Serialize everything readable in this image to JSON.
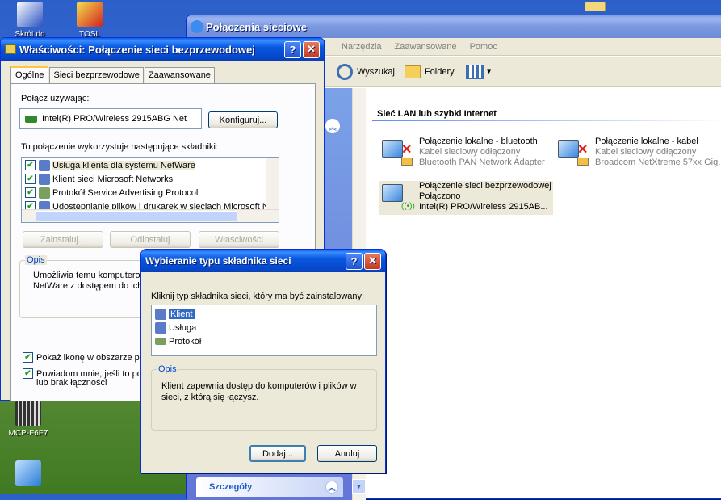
{
  "desktop": {
    "icons": [
      {
        "label": "Skrót do",
        "x": 0
      },
      {
        "label": "TOSL"
      },
      {
        "label": "MCP-F6F7"
      }
    ]
  },
  "explorer": {
    "title": "Połączenia sieciowe",
    "menu": [
      "Narzędzia",
      "Zaawansowane",
      "Pomoc"
    ],
    "toolbar": {
      "search": "Wyszukaj",
      "folders": "Foldery"
    },
    "group_header": "Sieć LAN lub szybki Internet",
    "connections": [
      {
        "name": "Połączenie lokalne - bluetooth",
        "status": "Kabel sieciowy odłączony",
        "device": "Bluetooth PAN Network Adapter"
      },
      {
        "name": "Połączenie lokalne - kabel",
        "status": "Kabel sieciowy odłączony",
        "device": "Broadcom NetXtreme 57xx Gig..."
      },
      {
        "name": "Połączenie sieci bezprzewodowej",
        "status": "Połączono",
        "device": "Intel(R) PRO/Wireless 2915AB..."
      }
    ],
    "details_label": "Szczegóły"
  },
  "props": {
    "title": "Właściwości: Połączenie sieci bezprzewodowej",
    "tabs": [
      "Ogólne",
      "Sieci bezprzewodowe",
      "Zaawansowane"
    ],
    "connect_using_label": "Połącz używając:",
    "adapter": "Intel(R) PRO/Wireless 2915ABG Net",
    "configure": "Konfiguruj...",
    "components_label": "To połączenie wykorzystuje następujące składniki:",
    "components": [
      "Usługa klienta dla systemu NetWare",
      "Klient sieci Microsoft Networks",
      "Protokół Service Advertising Protocol",
      "Udostępnianie plików i drukarek w sieciach Microsoft N"
    ],
    "install": "Zainstaluj...",
    "uninstall": "Odinstaluj",
    "properties": "Właściwości",
    "desc_label": "Opis",
    "desc_line1": "Umożliwia temu komputerow",
    "desc_line2": "NetWare z dostępem do ich",
    "show_icon": "Pokaż ikonę w obszarze pov",
    "notify_line1": "Powiadom mnie, jeśli to poła",
    "notify_line2": "lub brak łączności"
  },
  "dialog": {
    "title": "Wybieranie typu składnika sieci",
    "prompt": "Kliknij typ składnika sieci, który ma być zainstalowany:",
    "items": [
      "Klient",
      "Usługa",
      "Protokół"
    ],
    "desc_label": "Opis",
    "desc_line1": "Klient zapewnia dostęp do komputerów i plików w",
    "desc_line2": "sieci, z którą się łączysz.",
    "add": "Dodaj...",
    "cancel": "Anuluj"
  },
  "colors": {
    "selection": "#316ac5",
    "xp_blue": "#0a5de8",
    "panel_blue": "#6f8cde"
  }
}
